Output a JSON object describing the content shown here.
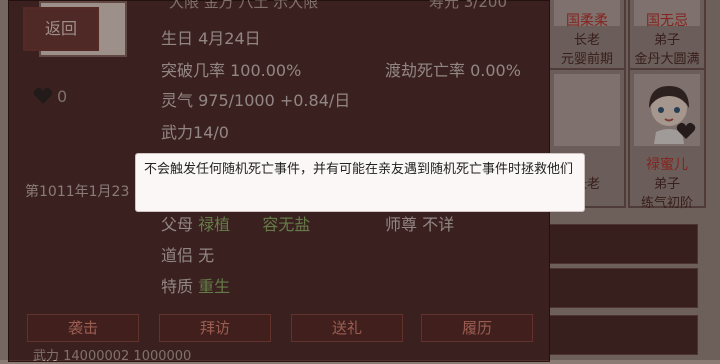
{
  "header": {
    "back_label": "返回",
    "partial_top_left": "大限 金万 八土 示大限",
    "partial_top_right": "寿元 3/200"
  },
  "profile": {
    "birthday_label": "生日",
    "birthday_value": "4月24日",
    "breakthrough_label": "突破几率",
    "breakthrough_value": "100.00%",
    "tribulation_death_label": "渡劫死亡率",
    "tribulation_death_value": "0.00%",
    "qi_label": "灵气",
    "qi_value": "975/1000 +0.84/日",
    "force_label": "武力",
    "force_value": "14/0",
    "affection_count": "0",
    "date_line": "第1011年1月23",
    "parents_label": "父母",
    "parents_value_1": "禄植",
    "parents_value_2": "容无盐",
    "mentor_label": "师尊",
    "mentor_value": "不详",
    "partner_label": "道侣",
    "partner_value": "无",
    "trait_label": "特质",
    "trait_value": "重生"
  },
  "actions": {
    "attack": "袭击",
    "visit": "拜访",
    "gift": "送礼",
    "history": "履历"
  },
  "tooltip": {
    "text": "不会触发任何随机死亡事件，并有可能在亲友遇到随机死亡事件时拯救他们"
  },
  "right_cards": [
    {
      "name": "国柔柔",
      "role": "长老",
      "status": "元婴前期"
    },
    {
      "name": "国无忌",
      "role": "弟子",
      "status": "金丹大圆满"
    },
    {
      "name": "",
      "role": "长老",
      "status": ""
    },
    {
      "name": "禄蜜儿",
      "role": "弟子",
      "status": "练气初阶"
    }
  ],
  "footer": {
    "partial_bottom": "武力 14000002 1000000"
  },
  "colors": {
    "panel": "#4f2f2c",
    "accent_green": "#8fb86b",
    "button_text": "#e48a7a",
    "tooltip_bg": "#fbf7f7"
  }
}
